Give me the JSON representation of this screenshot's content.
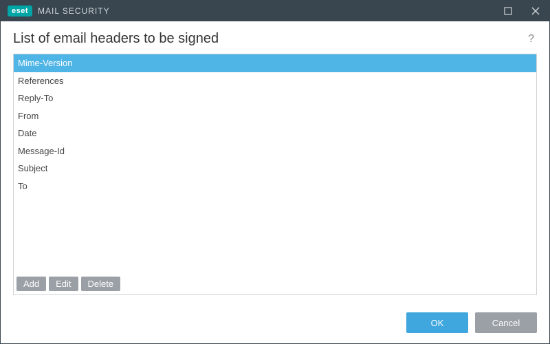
{
  "titlebar": {
    "brand_badge": "eset",
    "brand_text": "MAIL SECURITY"
  },
  "heading": "List of email headers to be signed",
  "help_label": "?",
  "headers": [
    {
      "label": "Mime-Version",
      "selected": true
    },
    {
      "label": "References",
      "selected": false
    },
    {
      "label": "Reply-To",
      "selected": false
    },
    {
      "label": "From",
      "selected": false
    },
    {
      "label": "Date",
      "selected": false
    },
    {
      "label": "Message-Id",
      "selected": false
    },
    {
      "label": "Subject",
      "selected": false
    },
    {
      "label": "To",
      "selected": false
    }
  ],
  "toolbar": {
    "add": "Add",
    "edit": "Edit",
    "delete": "Delete"
  },
  "footer": {
    "ok": "OK",
    "cancel": "Cancel"
  }
}
